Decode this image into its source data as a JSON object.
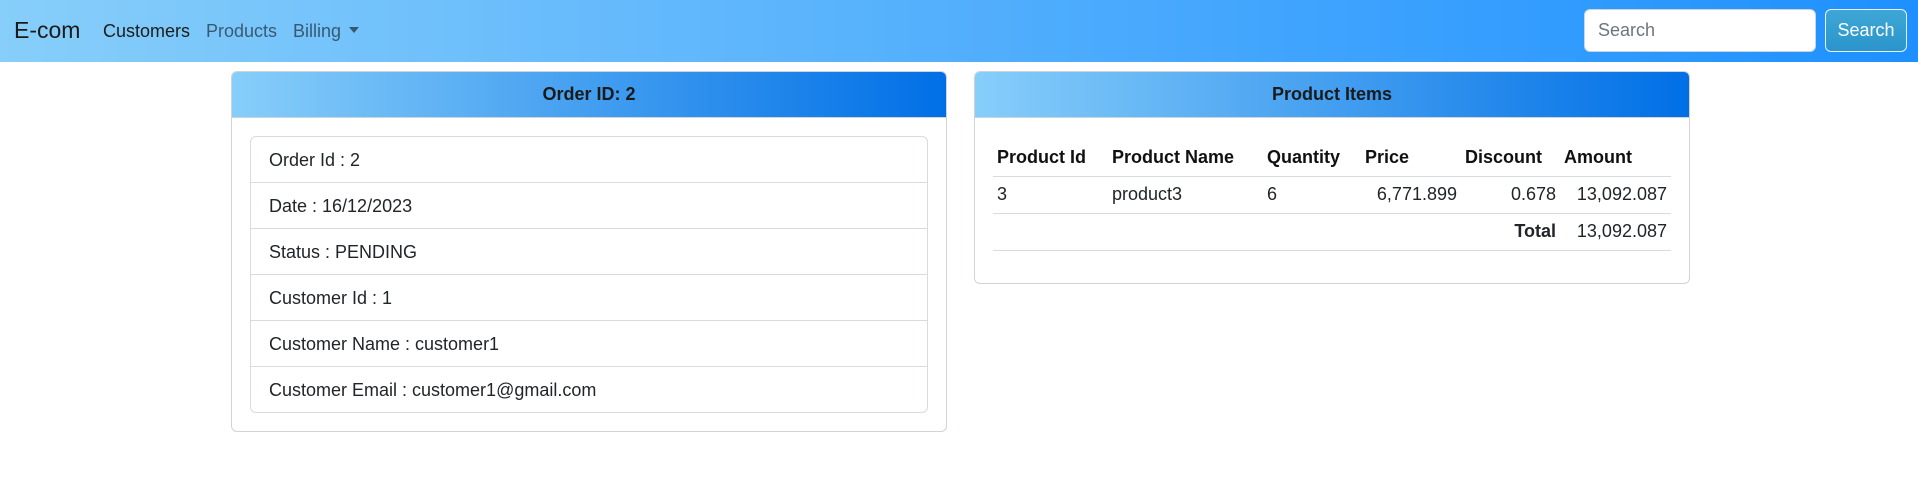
{
  "navbar": {
    "brand": "E-com",
    "items": [
      {
        "label": "Customers",
        "active": true
      },
      {
        "label": "Products",
        "active": false
      },
      {
        "label": "Billing",
        "active": false,
        "dropdown": true
      }
    ],
    "search": {
      "placeholder": "Search",
      "value": "",
      "button_label": "Search"
    },
    "colors": {
      "gradient_start": "#87cefa",
      "gradient_end": "#1e90ff"
    }
  },
  "order_card": {
    "title": "Order ID: 2",
    "details": [
      "Order Id : 2",
      "Date : 16/12/2023",
      "Status : PENDING",
      "Customer Id : 1",
      "Customer Name : customer1",
      "Customer Email : customer1@gmail.com"
    ]
  },
  "products_card": {
    "title": "Product Items",
    "columns": [
      "Product Id",
      "Product Name",
      "Quantity",
      "Price",
      "Discount",
      "Amount"
    ],
    "rows": [
      {
        "product_id": "3",
        "product_name": "product3",
        "quantity": "6",
        "price": "6,771.899",
        "discount": "0.678",
        "amount": "13,092.087"
      }
    ],
    "total_label": "Total",
    "total_value": "13,092.087"
  }
}
